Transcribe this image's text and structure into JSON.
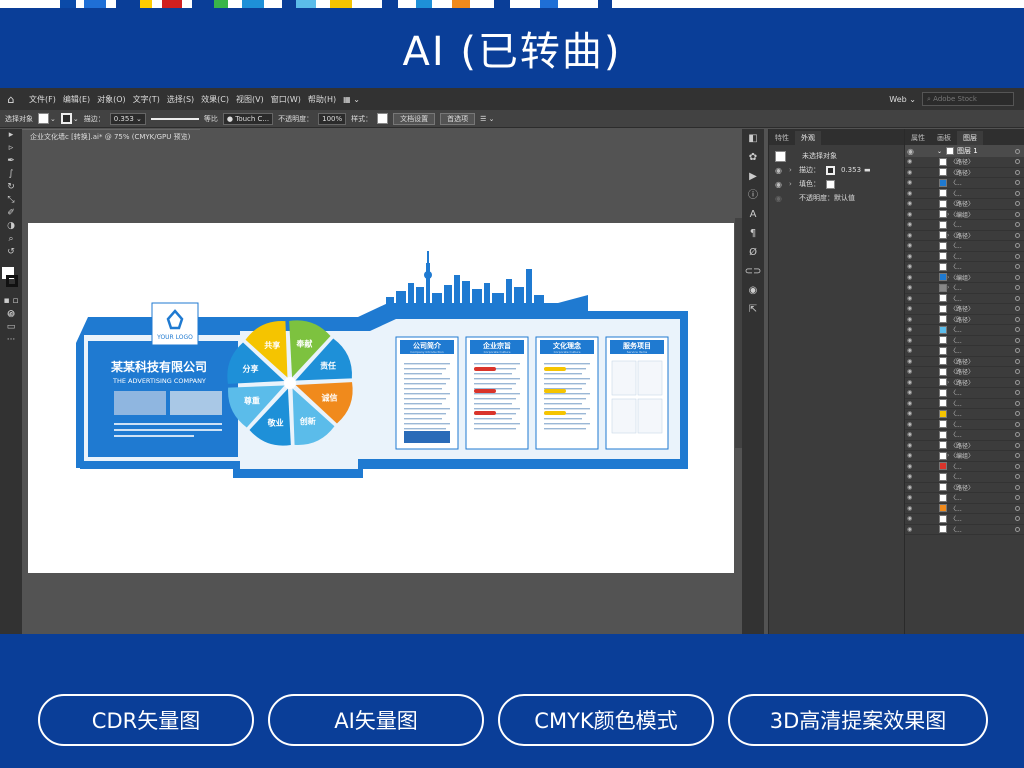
{
  "banner": {
    "title": "AI (已转曲)"
  },
  "menu": {
    "items": [
      "文件(F)",
      "编辑(E)",
      "对象(O)",
      "文字(T)",
      "选择(S)",
      "效果(C)",
      "视图(V)",
      "窗口(W)",
      "帮助(H)"
    ],
    "workspace": "Web",
    "stock_placeholder": "Adobe Stock"
  },
  "control": {
    "selection": "选择对象",
    "stroke_label": "描边：",
    "stroke_value": "0.353",
    "profile": "等比",
    "brush": "Touch C...",
    "opacity_label": "不透明度：",
    "opacity_value": "100%",
    "style_label": "样式：",
    "doc_setup": "文档设置",
    "prefs": "首选项"
  },
  "document": {
    "tab": "企业文化墙c [转换].ai* @ 75% (CMYK/GPU 预览)"
  },
  "artwork": {
    "logo_text": "YOUR LOGO",
    "company_cn": "某某科技有限公司",
    "company_en": "THE ADVERTISING COMPANY",
    "petals": [
      "共享",
      "奉献",
      "责任",
      "诚信",
      "创新",
      "敬业",
      "尊重",
      "分享"
    ],
    "petal_colors": [
      "#f5c400",
      "#7dc23f",
      "#1e90d8",
      "#f08a1c",
      "#5bbcea",
      "#1e90d8",
      "#5bbcea",
      "#1e90d8"
    ],
    "cards": [
      {
        "title": "公司简介",
        "sub": "Company Introduction"
      },
      {
        "title": "企业宗旨",
        "sub": "Corporate Culture"
      },
      {
        "title": "文化理念",
        "sub": "Corporate Culture"
      },
      {
        "title": "服务项目",
        "sub": "Service Items"
      }
    ],
    "accent": "#1f7ad1"
  },
  "appearance": {
    "tabs": [
      "特性",
      "外观"
    ],
    "no_selection": "未选择对象",
    "stroke_label": "描边：",
    "stroke_value": "0.353",
    "fill_label": "填色：",
    "opacity_label": "不透明度：默认值"
  },
  "layers": {
    "tabs": [
      "属性",
      "画板",
      "图层"
    ],
    "top_layer": "图层 1",
    "rows": [
      "〈路径〉",
      "〈路径〉",
      "〈...",
      "〈...",
      "〈路径〉",
      "〈编组〉",
      "〈...",
      "〈路径〉",
      "〈...",
      "〈...",
      "〈...",
      "〈编组〉",
      "〈...",
      "〈...",
      "〈路径〉",
      "〈路径〉",
      "〈...",
      "〈...",
      "〈...",
      "〈路径〉",
      "〈路径〉",
      "〈路径〉",
      "〈...",
      "〈...",
      "〈...",
      "〈...",
      "〈...",
      "〈路径〉",
      "〈编组〉",
      "〈...",
      "〈...",
      "〈路径〉",
      "〈...",
      "〈...",
      "〈...",
      "〈..."
    ]
  },
  "footer": {
    "buttons": [
      "CDR矢量图",
      "AI矢量图",
      "CMYK颜色模式",
      "3D高清提案效果图"
    ]
  },
  "colors": {
    "navy": "#0a3e98",
    "ui_dark": "#323232",
    "ui_mid": "#535353",
    "art_blue": "#1f7ad1"
  }
}
